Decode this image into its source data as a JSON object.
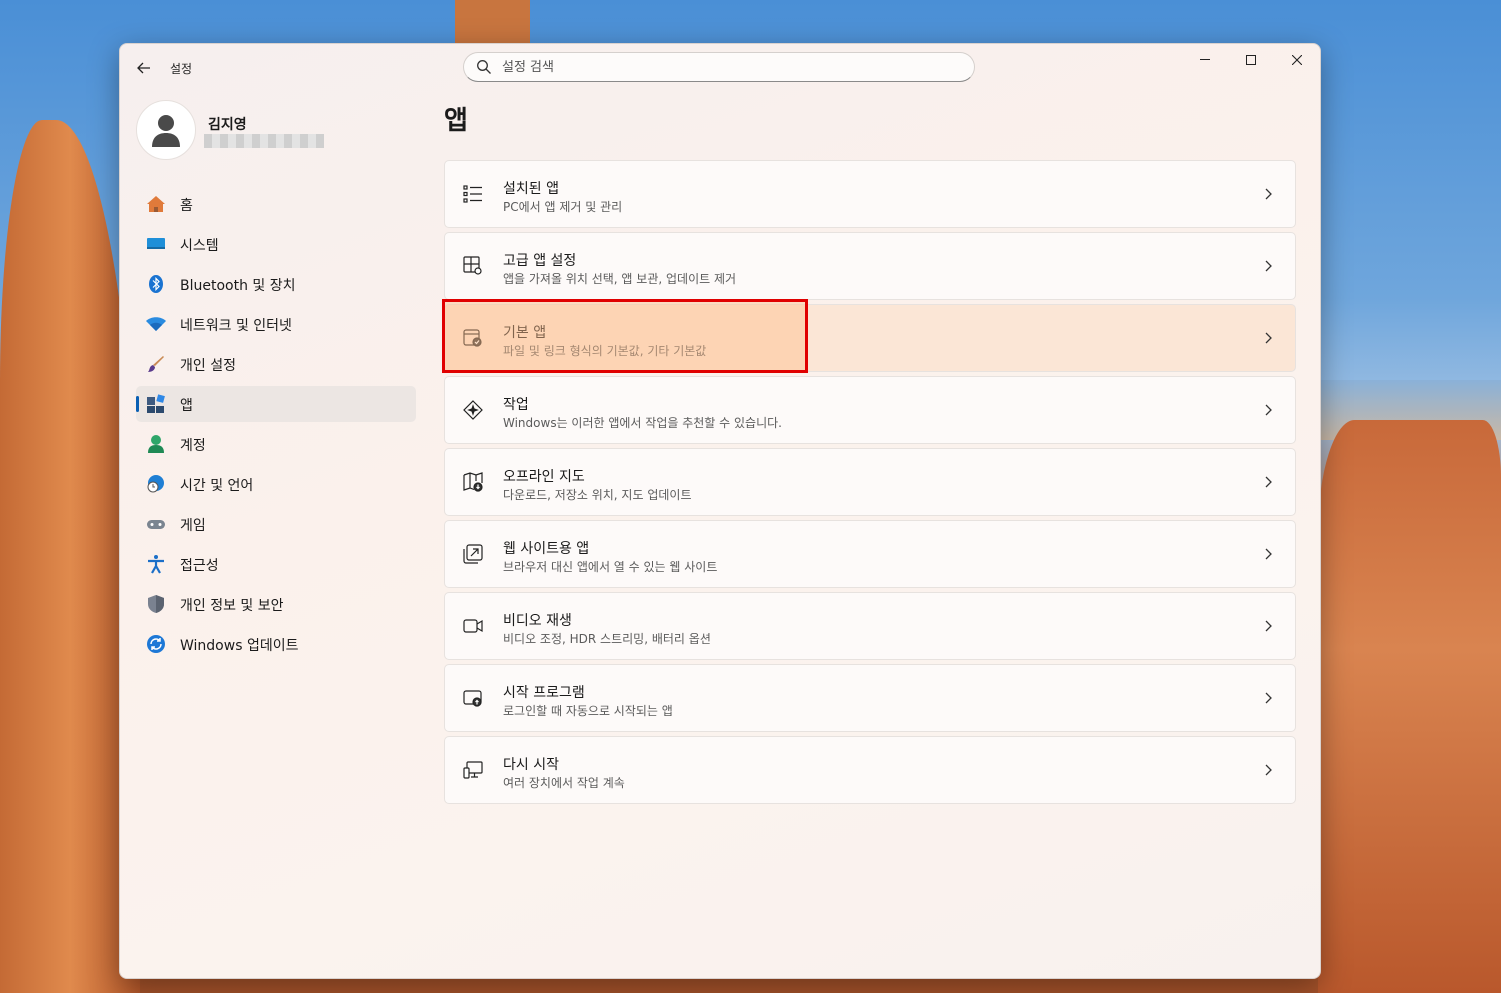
{
  "window": {
    "app_title": "설정",
    "search_placeholder": "설정 검색"
  },
  "profile": {
    "name": "김지영"
  },
  "sidebar": {
    "items": [
      {
        "label": "홈",
        "icon": "home-icon"
      },
      {
        "label": "시스템",
        "icon": "system-icon"
      },
      {
        "label": "Bluetooth 및 장치",
        "icon": "bluetooth-icon"
      },
      {
        "label": "네트워크 및 인터넷",
        "icon": "wifi-icon"
      },
      {
        "label": "개인 설정",
        "icon": "brush-icon"
      },
      {
        "label": "앱",
        "icon": "apps-icon",
        "active": true
      },
      {
        "label": "계정",
        "icon": "account-icon"
      },
      {
        "label": "시간 및 언어",
        "icon": "globe-clock-icon"
      },
      {
        "label": "게임",
        "icon": "gamepad-icon"
      },
      {
        "label": "접근성",
        "icon": "accessibility-icon"
      },
      {
        "label": "개인 정보 및 보안",
        "icon": "shield-icon"
      },
      {
        "label": "Windows 업데이트",
        "icon": "update-icon"
      }
    ]
  },
  "main": {
    "title": "앱",
    "cards": [
      {
        "title": "설치된 앱",
        "subtitle": "PC에서 앱 제거 및 관리",
        "icon": "list-icon"
      },
      {
        "title": "고급 앱 설정",
        "subtitle": "앱을 가져올 위치 선택, 앱 보관, 업데이트 제거",
        "icon": "app-settings-icon"
      },
      {
        "title": "기본 앱",
        "subtitle": "파일 및 링크 형식의 기본값, 기타 기본값",
        "icon": "default-apps-icon",
        "highlighted": true
      },
      {
        "title": "작업",
        "subtitle": "Windows는 이러한 앱에서 작업을 추천할 수 있습니다.",
        "icon": "actions-icon"
      },
      {
        "title": "오프라인 지도",
        "subtitle": "다운로드, 저장소 위치, 지도 업데이트",
        "icon": "map-icon"
      },
      {
        "title": "웹 사이트용 앱",
        "subtitle": "브라우저 대신 앱에서 열 수 있는 웹 사이트",
        "icon": "open-in-app-icon"
      },
      {
        "title": "비디오 재생",
        "subtitle": "비디오 조정, HDR 스트리밍, 배터리 옵션",
        "icon": "video-icon"
      },
      {
        "title": "시작 프로그램",
        "subtitle": "로그인할 때 자동으로 시작되는 앱",
        "icon": "startup-icon"
      },
      {
        "title": "다시 시작",
        "subtitle": "여러 장치에서 작업 계속",
        "icon": "resume-icon"
      }
    ]
  },
  "colors": {
    "accent": "#0a5fb3",
    "highlight_border": "#e00000"
  }
}
